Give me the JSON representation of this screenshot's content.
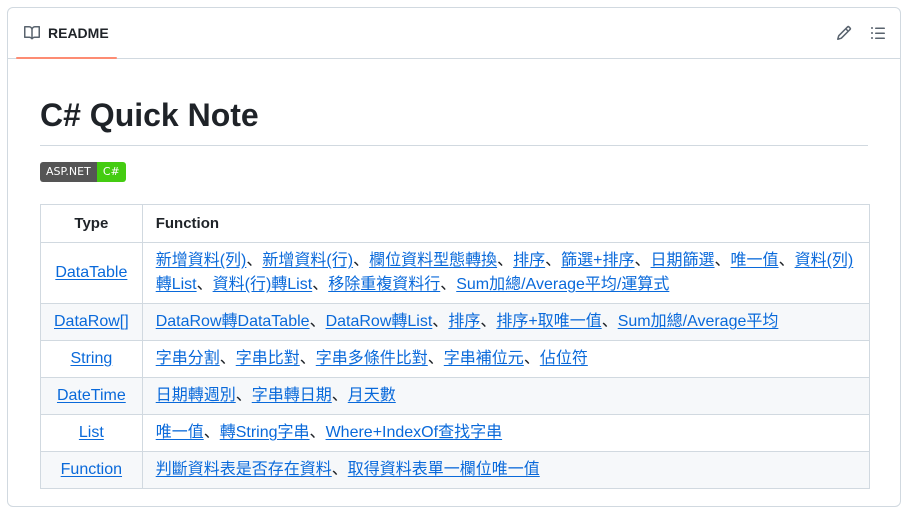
{
  "tab": {
    "label": "README",
    "icon": "book-icon"
  },
  "actions": {
    "edit_icon": "pencil-icon",
    "outline_icon": "list-unordered-icon"
  },
  "title": "C# Quick Note",
  "badge": {
    "left": "ASP.NET",
    "right": "C#",
    "left_color": "#555555",
    "right_color": "#44cc11"
  },
  "table": {
    "headers": [
      "Type",
      "Function"
    ],
    "separator": "、",
    "rows": [
      {
        "type": "DataTable",
        "links": [
          "新增資料(列)",
          "新增資料(行)",
          "欄位資料型態轉換",
          "排序",
          "篩選+排序",
          "日期篩選",
          "唯一值",
          "資料(列)轉List",
          "資料(行)轉List",
          "移除重複資料行",
          "Sum加總/Average平均/運算式"
        ]
      },
      {
        "type": "DataRow[]",
        "links": [
          "DataRow轉DataTable",
          "DataRow轉List",
          "排序",
          "排序+取唯一值",
          "Sum加總/Average平均"
        ]
      },
      {
        "type": "String",
        "links": [
          "字串分割",
          "字串比對",
          "字串多條件比對",
          "字串補位元",
          "佔位符"
        ]
      },
      {
        "type": "DateTime",
        "links": [
          "日期轉週別",
          "字串轉日期",
          "月天數"
        ]
      },
      {
        "type": "List",
        "links": [
          "唯一值",
          "轉String字串",
          "Where+IndexOf查找字串"
        ]
      },
      {
        "type": "Function",
        "links": [
          "判斷資料表是否存在資料",
          "取得資料表單一欄位唯一值"
        ]
      }
    ]
  },
  "colors": {
    "link": "#0969da",
    "tab_underline": "#fd8c73",
    "border": "#d1d9e0",
    "alt_row": "#f6f8fa"
  }
}
